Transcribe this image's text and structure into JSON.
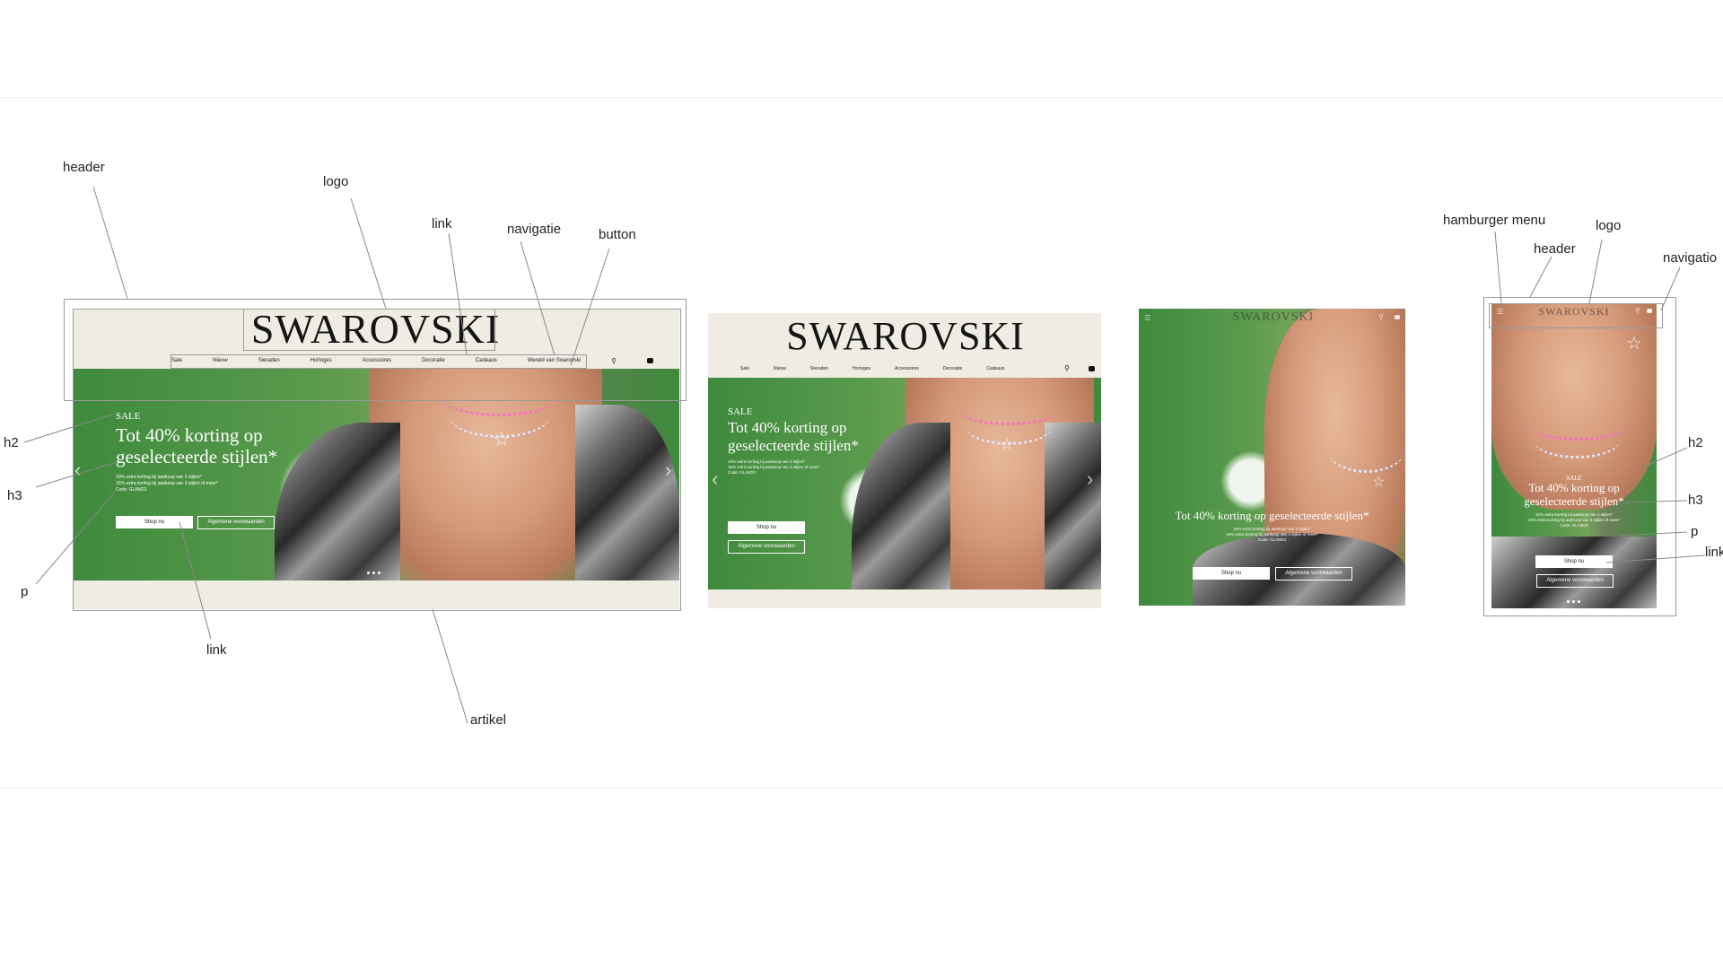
{
  "brand": {
    "logo": "SWAROVSKI"
  },
  "nav": {
    "items": [
      "Sale",
      "Nieuw",
      "Sieraden",
      "Horloges",
      "Accessoires",
      "Decoratie",
      "Cadeaus",
      "Wereld van Swarovski"
    ],
    "items_tablet": [
      "Sale",
      "Nieuw",
      "Sieraden",
      "Horloges",
      "Accessoires",
      "Decoratie",
      "Cadeaus"
    ]
  },
  "hero": {
    "eyebrow": "SALE",
    "title": "Tot 40% korting op geselecteerde stijlen*",
    "details": [
      "10% extra korting bij aankoop van 2 stijlen*",
      "15% extra korting bij aankoop van 3 stijlen of meer*",
      "Code: GLAM23"
    ],
    "cta_primary": "Shop nu",
    "cta_secondary": "Algemene voorwaarden"
  },
  "annotations": {
    "header": "header",
    "logo": "logo",
    "link": "link",
    "navigatie": "navigatie",
    "button": "button",
    "h2": "h2",
    "h3": "h3",
    "p": "p",
    "artikel": "artikel",
    "hamburger": "hamburger menu",
    "navigation_cut": "navigatio",
    "link_cut": "link"
  },
  "colors": {
    "green": "#3f8a3d",
    "cream": "#efece3",
    "annotation_line": "#888888"
  },
  "icons": [
    "search-icon",
    "bag-icon",
    "hamburger-icon",
    "chevron-left-icon",
    "chevron-right-icon"
  ]
}
